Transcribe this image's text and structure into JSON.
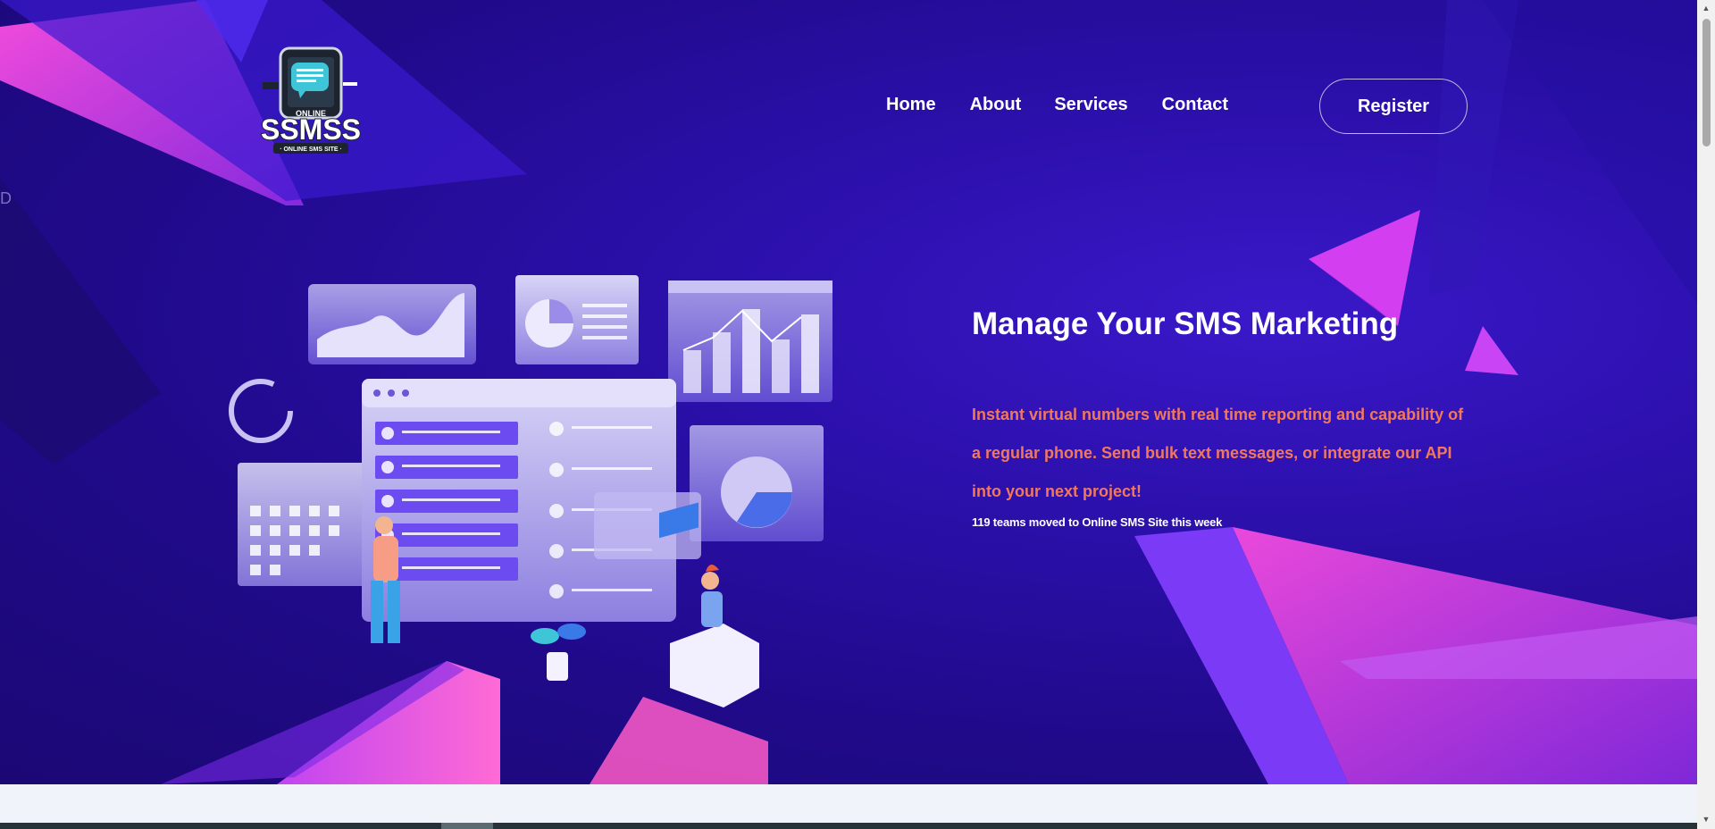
{
  "logo": {
    "badge_text": "ONLINE",
    "brand": "SSMSS",
    "tagline": "· ONLINE SMS SITE ·",
    "icon": "phone-chat-logo"
  },
  "nav": {
    "items": [
      {
        "label": "Home"
      },
      {
        "label": "About"
      },
      {
        "label": "Services"
      },
      {
        "label": "Contact"
      }
    ]
  },
  "register_label": "Register",
  "stray_text": "D",
  "hero": {
    "headline": "Manage Your SMS Marketing",
    "description": "Instant virtual numbers with real time reporting and capability of a regular phone. Send bulk text messages, or integrate our API into your next project!",
    "teams_note": "119 teams moved to Online SMS Site this week",
    "illustration": "dashboard-analytics-illustration"
  },
  "colors": {
    "hero_bg": "#2a0fa8",
    "accent_pink": "#e040fb",
    "description": "#f2785c"
  }
}
